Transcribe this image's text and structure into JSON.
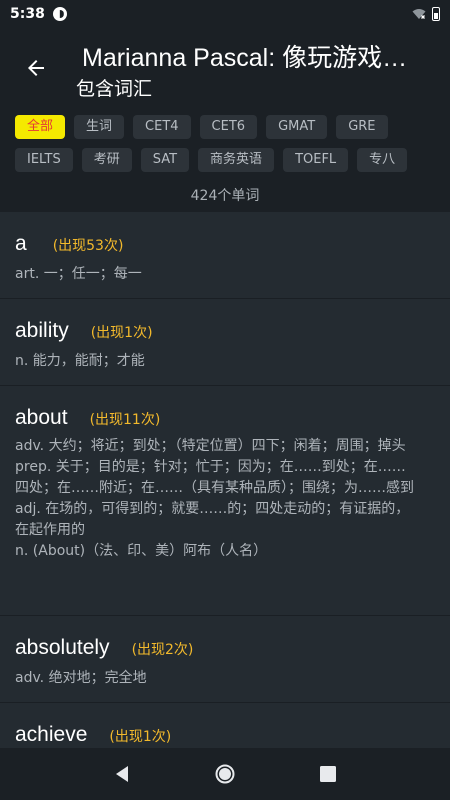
{
  "status": {
    "time": "5:38",
    "app_icon": "app-notification-icon",
    "wifi_icon": "wifi-icon",
    "battery_icon": "battery-icon"
  },
  "header": {
    "back_icon": "arrow-back-icon",
    "title": "Marianna Pascal: 像玩游戏…",
    "subtitle": "包含词汇"
  },
  "filters": {
    "row1": [
      "全部",
      "生词",
      "CET4",
      "CET6",
      "GMAT",
      "GRE"
    ],
    "row2": [
      "IELTS",
      "考研",
      "SAT",
      "商务英语",
      "TOEFL",
      "专八"
    ],
    "active": "全部",
    "count_text": "424个单词"
  },
  "words": [
    {
      "term": "a",
      "freq": "(出现53次)",
      "definitions": [
        "art. 一；任一；每一"
      ]
    },
    {
      "term": "ability",
      "freq": "(出现1次)",
      "definitions": [
        "n. 能力，能耐；才能"
      ]
    },
    {
      "term": "about",
      "freq": "(出现11次)",
      "definitions": [
        "adv. 大约；将近；到处；（特定位置）四下；闲着；周围；掉头",
        "prep. 关于；目的是；针对；忙于；因为；在……到处；在……四处；在……附近；在……（具有某种品质）；围绕；为……感到",
        "adj. 在场的，可得到的；就要……的；四处走动的；有证据的，在起作用的",
        "n. (About)（法、印、美）阿布（人名）"
      ]
    },
    {
      "term": "absolutely",
      "freq": "(出现2次)",
      "definitions": [
        "adv. 绝对地；完全地"
      ]
    },
    {
      "term": "achieve",
      "freq": "(出现1次)",
      "definitions": []
    }
  ],
  "nav": {
    "back": "nav-back-icon",
    "home": "nav-home-icon",
    "recents": "nav-recents-icon"
  },
  "colors": {
    "background": "#1e2328",
    "accent_chip": "#f5e900",
    "accent_chip_text": "#e53935",
    "freq_text": "#f2b92c"
  }
}
